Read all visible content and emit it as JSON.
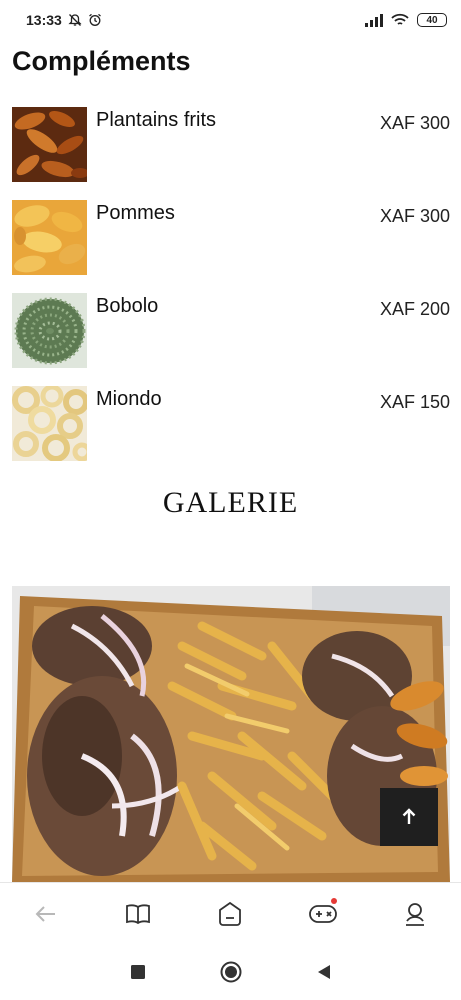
{
  "status_bar": {
    "time": "13:33",
    "battery": "40",
    "icons": [
      "bell-off-icon",
      "alarm-icon",
      "signal-icon",
      "wifi-icon",
      "battery-icon"
    ]
  },
  "section": {
    "title": "Compléments"
  },
  "items": [
    {
      "name": "Plantains frits",
      "price": "XAF 300"
    },
    {
      "name": "Pommes",
      "price": "XAF 300"
    },
    {
      "name": "Bobolo",
      "price": "XAF 200"
    },
    {
      "name": "Miondo",
      "price": "XAF 150"
    }
  ],
  "gallery": {
    "title": "GALERIE"
  },
  "bottom_nav": {
    "icons": [
      "back-arrow-icon",
      "book-icon",
      "home-icon",
      "gamepad-icon",
      "profile-icon"
    ]
  },
  "system_nav": {
    "icons": [
      "recents-square-icon",
      "home-circle-icon",
      "back-triangle-icon"
    ]
  },
  "colors": {
    "accent_dot": "#e53935",
    "button_dark": "#1f1f1f"
  }
}
